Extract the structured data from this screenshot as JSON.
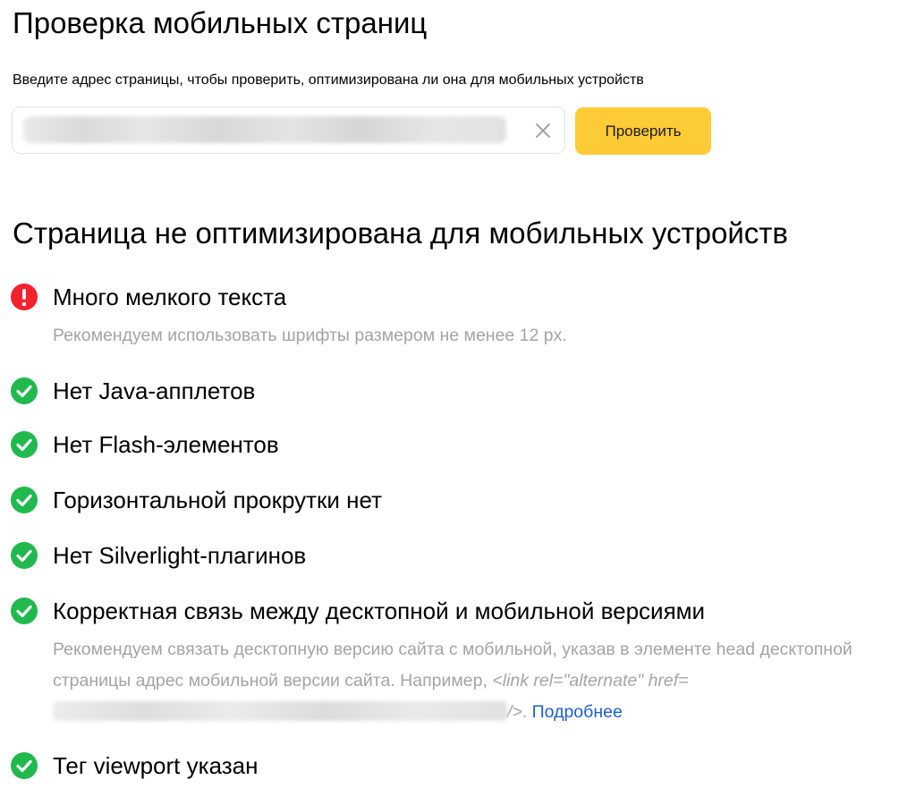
{
  "header": {
    "title": "Проверка мобильных страниц",
    "subtitle": "Введите адрес страницы, чтобы проверить, оптимизирована ли она для мобильных устройств"
  },
  "search": {
    "value": "",
    "clear_icon": "close-icon",
    "button_label": "Проверить",
    "button_color": "#fdcb35"
  },
  "result": {
    "title": "Страница не оптимизирована для мобильных устройств",
    "checks": [
      {
        "status": "error",
        "icon": "exclamation-icon",
        "label": "Много мелкого текста",
        "note": "Рекомендуем использовать шрифты размером не менее 12 px."
      },
      {
        "status": "ok",
        "icon": "check-icon",
        "label": "Нет Java-апплетов"
      },
      {
        "status": "ok",
        "icon": "check-icon",
        "label": "Нет Flash-элементов"
      },
      {
        "status": "ok",
        "icon": "check-icon",
        "label": "Горизонтальной прокрутки нет"
      },
      {
        "status": "ok",
        "icon": "check-icon",
        "label": "Нет Silverlight-плагинов"
      },
      {
        "status": "ok",
        "icon": "check-icon",
        "label": "Корректная связь между десктопной и мобильной версиями",
        "note_text": "Рекомендуем связать десктопную версию сайта с мобильной, указав в элементе head десктопной страницы адрес мобильной версии сайта. Например, ",
        "note_code_start": "<link rel=\"alternate\" href=",
        "note_code_end": "/>",
        "note_end": ". ",
        "more_link": "Подробнее"
      },
      {
        "status": "ok",
        "icon": "check-icon",
        "label": "Тег viewport указан"
      }
    ]
  },
  "colors": {
    "error": "#f5222d",
    "ok": "#21b94d",
    "muted_text": "#a4a4a4",
    "link": "#1d5fd1"
  }
}
